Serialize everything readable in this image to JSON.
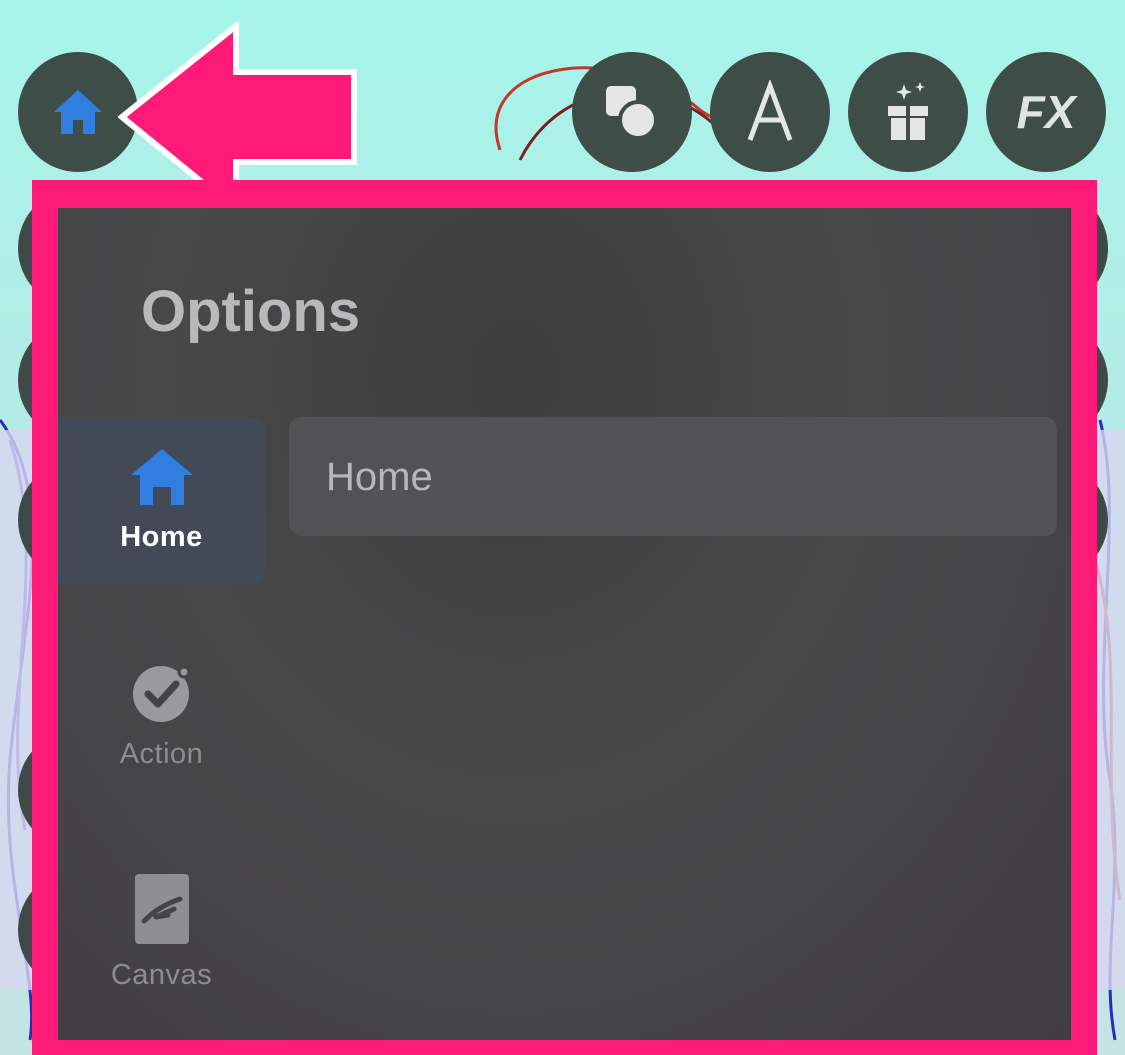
{
  "toolbar": {
    "tools": [
      {
        "icon": "home-icon",
        "active_color": "#2f7ee0"
      },
      {
        "icon": "shapes-icon"
      },
      {
        "icon": "text-icon",
        "label": "A"
      },
      {
        "icon": "gift-icon"
      },
      {
        "icon": "fx-icon",
        "label": "FX"
      }
    ]
  },
  "options_panel": {
    "title": "Options",
    "sidebar": [
      {
        "label": "Home",
        "icon": "home-icon",
        "active": true
      },
      {
        "label": "Action",
        "icon": "check-circle-icon",
        "active": false
      },
      {
        "label": "Canvas",
        "icon": "canvas-icon",
        "active": false
      }
    ],
    "breadcrumb": "Home"
  },
  "colors": {
    "highlight": "#ff1a78",
    "accent_blue": "#2f7ee0",
    "panel_bg": "#444345",
    "tool_bg": "#3f4d49"
  }
}
